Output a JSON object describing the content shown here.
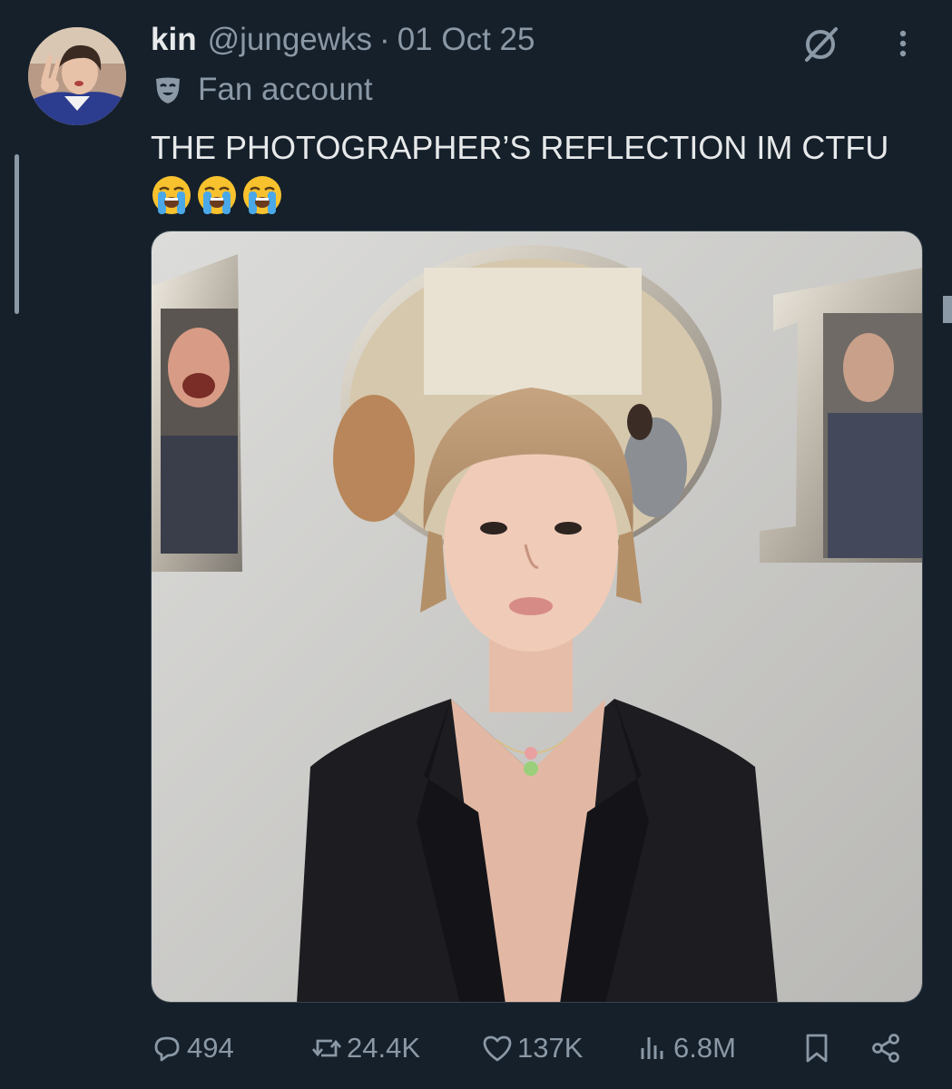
{
  "post": {
    "display_name": "kin",
    "handle": "@jungewks",
    "separator": "·",
    "date": "01 Oct 25",
    "account_label": "Fan account",
    "text": "THE PHOTOGRAPHER’S REFLECTION IM CTFU",
    "emoji": [
      "loudly-crying-face",
      "loudly-crying-face",
      "loudly-crying-face"
    ]
  },
  "actions": {
    "replies": "494",
    "reposts": "24.4K",
    "likes": "137K",
    "views": "6.8M"
  },
  "icons": {
    "grok": "grok-icon",
    "more": "more-icon",
    "label": "mask-icon",
    "reply": "reply-icon",
    "repost": "repost-icon",
    "like": "heart-icon",
    "views": "views-icon",
    "bookmark": "bookmark-icon",
    "share": "share-icon"
  },
  "colors": {
    "background": "#15202b",
    "text_primary": "#e7e9ea",
    "text_secondary": "#8b98a5"
  }
}
